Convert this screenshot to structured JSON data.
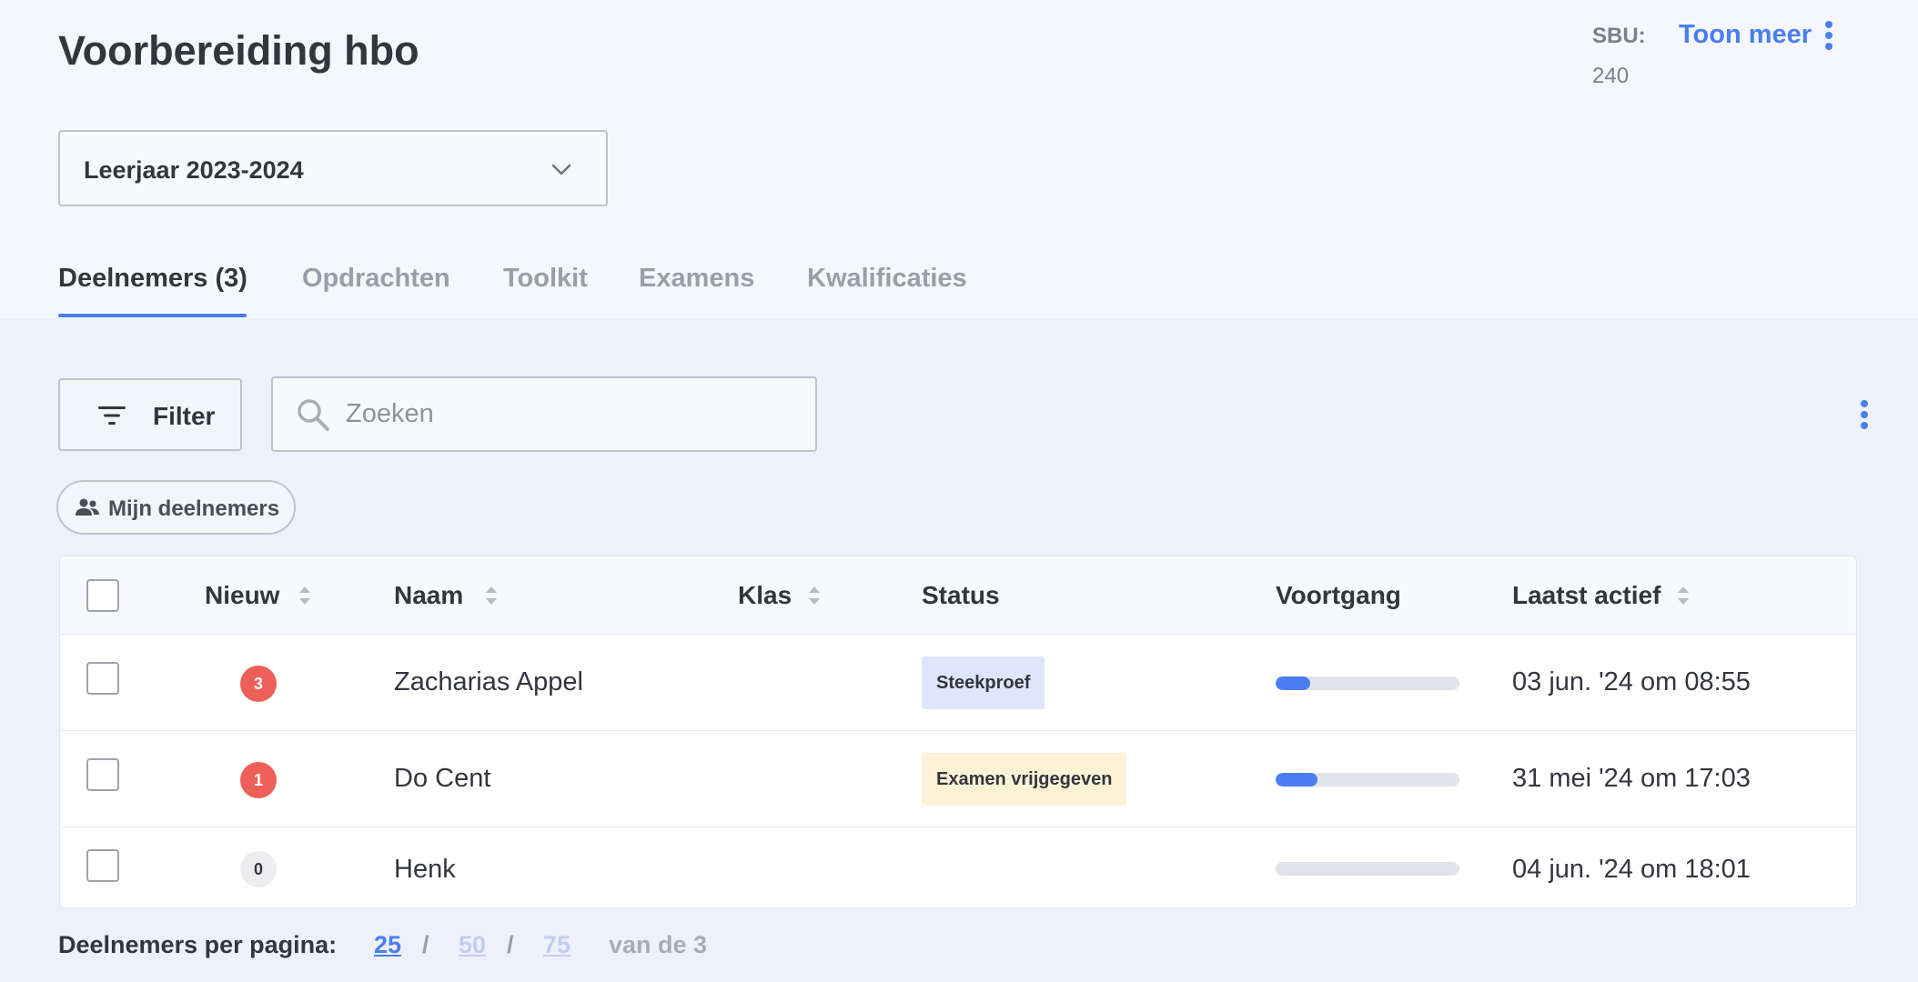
{
  "header": {
    "title": "Voorbereiding hbo",
    "sbu_label": "SBU:",
    "sbu_value": "240",
    "more_label": "Toon meer",
    "more_icon": "kebab-icon"
  },
  "year_select": {
    "value": "Leerjaar 2023-2024",
    "icon": "chevron-down-icon"
  },
  "tabs": [
    {
      "label": "Deelnemers (3)",
      "active": true
    },
    {
      "label": "Opdrachten",
      "active": false
    },
    {
      "label": "Toolkit",
      "active": false
    },
    {
      "label": "Examens",
      "active": false
    },
    {
      "label": "Kwalificaties",
      "active": false
    }
  ],
  "toolbar": {
    "filter_label": "Filter",
    "filter_icon": "filter-icon",
    "search_placeholder": "Zoeken",
    "search_value": "",
    "search_icon": "search-icon",
    "chip_label": "Mijn deelnemers",
    "chip_icon": "users-icon"
  },
  "table": {
    "columns": [
      "Nieuw",
      "Naam",
      "Klas",
      "Status",
      "Voortgang",
      "Laatst actief"
    ],
    "rows": [
      {
        "nieuw": "3",
        "naam": "Zacharias Appel",
        "klas": "",
        "status": "Steekproef",
        "voortgang": 0.19,
        "laatst_actief": "03 jun. '24 om 08:55"
      },
      {
        "nieuw": "1",
        "naam": "Do Cent",
        "klas": "",
        "status": "Examen vrijgegeven",
        "voortgang": 0.23,
        "laatst_actief": "31 mei '24 om 17:03"
      },
      {
        "nieuw": "0",
        "naam": "Henk",
        "klas": "",
        "status": "",
        "voortgang": 0,
        "laatst_actief": "04 jun. '24 om 18:01"
      }
    ]
  },
  "pagination": {
    "label": "Deelnemers per pagina:",
    "options": [
      "25",
      "50",
      "75"
    ],
    "selected": "25",
    "separator": "/",
    "total_text": "van de 3"
  },
  "colors": {
    "accent": "#4a7ef0",
    "badge_red": "#ee5f5a",
    "status_blue_bg": "#dde6fb",
    "status_yellow_bg": "#fdf2d6"
  }
}
